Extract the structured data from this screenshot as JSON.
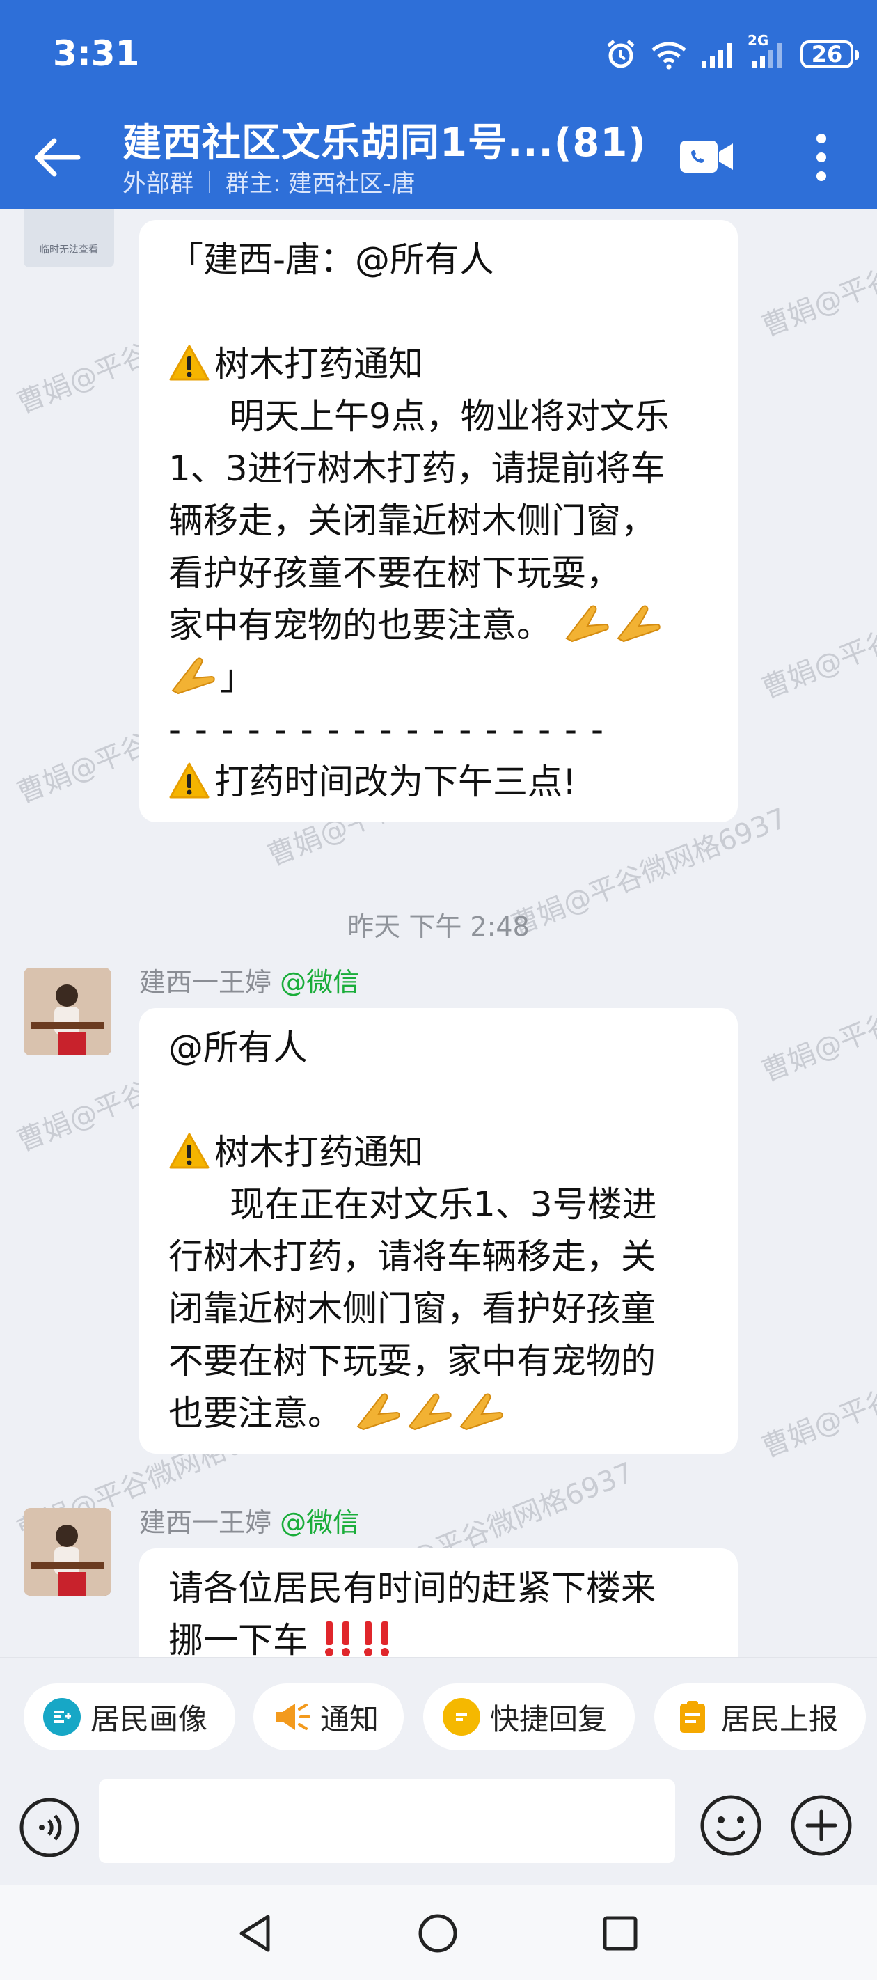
{
  "status": {
    "time": "3:31",
    "network": "2G",
    "battery": "26"
  },
  "header": {
    "title": "建西社区文乐胡同1号...(81)",
    "group_type": "外部群",
    "owner": "群主: 建西社区-唐"
  },
  "watermark": "曹娟@平谷微网格6937",
  "preview_thumb_text": "临时无法查看",
  "messages": [
    {
      "lines": [
        "「建西-唐：@所有人",
        "",
        "树木打药通知",
        "明天上午9点，物业将对文乐",
        "1、3进行树木打药，请提前将车",
        "辆移走，关闭靠近树木侧门窗，",
        "看护好孩童不要在树下玩耍，",
        "家中有宠物的也要注意。",
        "」",
        "- - - - - - - - - - - - - - - - -",
        "打药时间改为下午三点!"
      ]
    },
    {
      "sender": "建西一王婷",
      "sender_tag": "@微信",
      "lines": [
        "@所有人",
        "",
        "树木打药通知",
        "现在正在对文乐1、3号楼进",
        "行树木打药，请将车辆移走，关",
        "闭靠近树木侧门窗，看护好孩童",
        "不要在树下玩耍，家中有宠物的",
        "也要注意。"
      ]
    },
    {
      "sender": "建西一王婷",
      "sender_tag": "@微信",
      "lines": [
        "请各位居民有时间的赶紧下楼来",
        "挪一下车"
      ]
    }
  ],
  "timestamp": "昨天  下午 2:48",
  "quick_actions": [
    "居民画像",
    "通知",
    "快捷回复",
    "居民上报"
  ],
  "colors": {
    "accent": "#2e6fd8",
    "wechat_green": "#1aad3a",
    "background": "#eef0f5"
  }
}
